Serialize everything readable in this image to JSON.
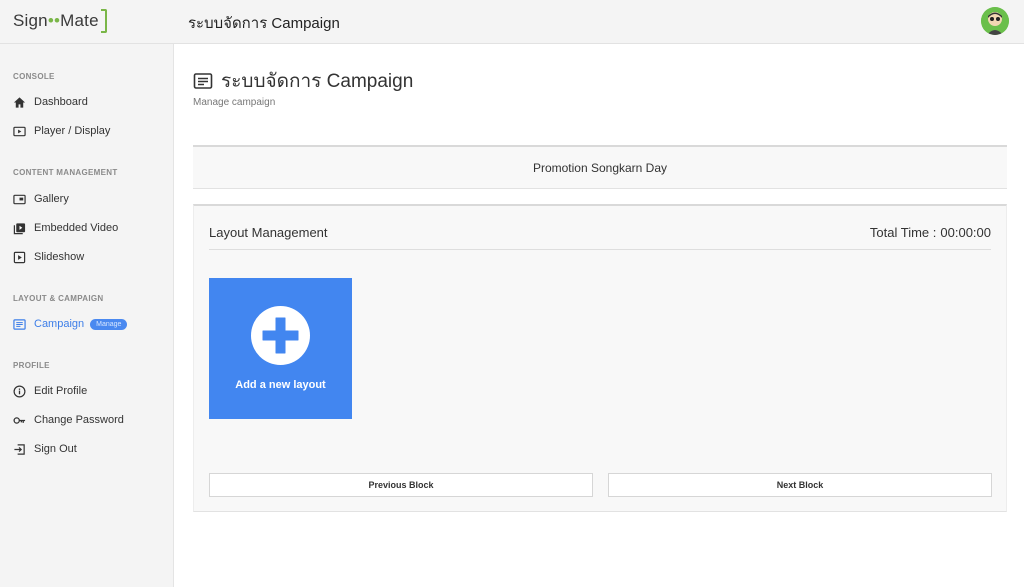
{
  "header": {
    "logo_sign": "Sign",
    "logo_mate": "Mate",
    "title": "ระบบจัดการ Campaign"
  },
  "sidebar": {
    "sections": [
      {
        "title": "CONSOLE",
        "items": [
          {
            "label": "Dashboard",
            "icon": "home-icon"
          },
          {
            "label": "Player / Display",
            "icon": "player-icon"
          }
        ]
      },
      {
        "title": "CONTENT MANAGEMENT",
        "items": [
          {
            "label": "Gallery",
            "icon": "gallery-icon"
          },
          {
            "label": "Embedded Video",
            "icon": "video-library-icon"
          },
          {
            "label": "Slideshow",
            "icon": "slideshow-icon"
          }
        ]
      },
      {
        "title": "LAYOUT & CAMPAIGN",
        "items": [
          {
            "label": "Campaign",
            "icon": "campaign-icon",
            "badge": "Manage",
            "active": true
          }
        ]
      },
      {
        "title": "PROFILE",
        "items": [
          {
            "label": "Edit Profile",
            "icon": "info-icon"
          },
          {
            "label": "Change Password",
            "icon": "key-icon"
          },
          {
            "label": "Sign Out",
            "icon": "sign-out-icon"
          }
        ]
      }
    ]
  },
  "main": {
    "title": "ระบบจัดการ Campaign",
    "subtitle": "Manage campaign",
    "campaign_name": "Promotion Songkarn Day",
    "layout_panel": {
      "title": "Layout Management",
      "total_time_label": "Total Time :",
      "total_time_value": "00:00:00",
      "add_label": "Add a new layout",
      "prev_label": "Previous Block",
      "next_label": "Next Block"
    }
  },
  "colors": {
    "accent": "#3d7ee8",
    "tile": "#4286f0",
    "logo_green": "#7ab648"
  }
}
